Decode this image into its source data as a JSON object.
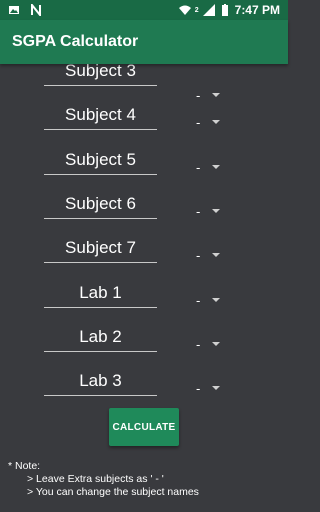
{
  "status_bar": {
    "time": "7:47 PM",
    "signal_label": "2",
    "icons": [
      "image-icon",
      "n-icon",
      "wifi-icon",
      "signal-icon",
      "battery-icon"
    ]
  },
  "app_bar": {
    "title": "SGPA Calculator"
  },
  "subjects": [
    {
      "name": "Subject 3",
      "grade": "-"
    },
    {
      "name": "Subject 4",
      "grade": "-"
    },
    {
      "name": "Subject 5",
      "grade": "-"
    },
    {
      "name": "Subject 6",
      "grade": "-"
    },
    {
      "name": "Subject 7",
      "grade": "-"
    },
    {
      "name": "Lab 1",
      "grade": "-"
    },
    {
      "name": "Lab 2",
      "grade": "-"
    },
    {
      "name": "Lab 3",
      "grade": "-"
    }
  ],
  "calculate_label": "CALCULATE",
  "note": {
    "heading": "* Note:",
    "lines": [
      "> Leave Extra subjects as ' - '",
      "> You can change the subject names"
    ]
  },
  "colors": {
    "status_bar": "#196a45",
    "app_bar": "#1f7a52",
    "background": "#393a3e",
    "button": "#1f8a5a"
  }
}
